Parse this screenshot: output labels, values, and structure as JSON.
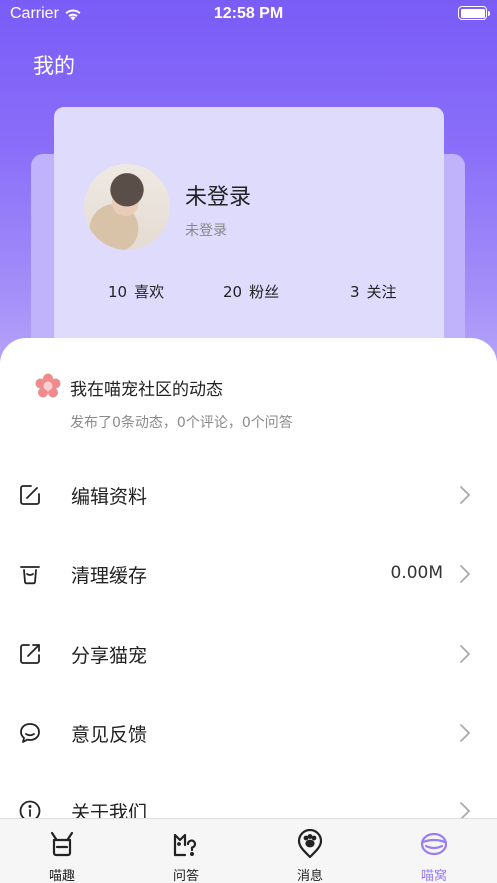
{
  "status_bar": {
    "carrier": "Carrier",
    "time": "12:58 PM"
  },
  "page": {
    "title": "我的"
  },
  "profile": {
    "name": "未登录",
    "subtitle": "未登录",
    "stats": [
      {
        "value": "10",
        "label": "喜欢"
      },
      {
        "value": "20",
        "label": "粉丝"
      },
      {
        "value": "3",
        "label": "关注"
      }
    ]
  },
  "activity": {
    "title": "我在喵宠社区的动态",
    "summary": "发布了0条动态，0个评论，0个问答"
  },
  "menu": [
    {
      "label": "编辑资料",
      "value": "",
      "icon": "edit-icon"
    },
    {
      "label": "清理缓存",
      "value": "0.00M",
      "icon": "trash-icon"
    },
    {
      "label": "分享猫宠",
      "value": "",
      "icon": "share-icon"
    },
    {
      "label": "意见反馈",
      "value": "",
      "icon": "feedback-icon"
    },
    {
      "label": "关于我们",
      "value": "",
      "icon": "info-icon"
    }
  ],
  "tabbar": {
    "active": "喵窝",
    "tabs": [
      {
        "label": "喵趣",
        "icon": "cat-face-icon"
      },
      {
        "label": "问答",
        "icon": "cat-question-icon"
      },
      {
        "label": "消息",
        "icon": "paw-pin-icon"
      },
      {
        "label": "喵窝",
        "icon": "cat-bed-icon"
      }
    ]
  },
  "colors": {
    "header_gradient_top": "#7a5cf7",
    "card": "#dfdbfd",
    "accent": "#9a7df2",
    "flower": "#f08b8b"
  }
}
